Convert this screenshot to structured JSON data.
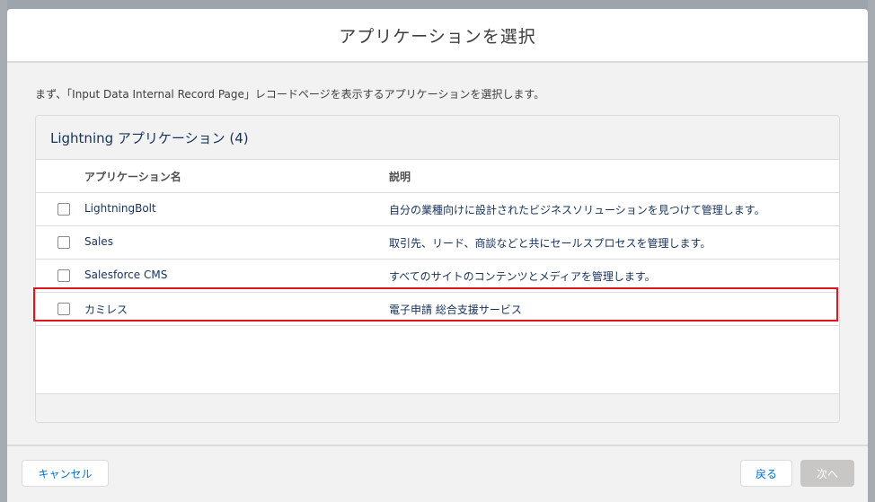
{
  "modal": {
    "title": "アプリケーションを選択",
    "instruction": "まず、「Input Data Internal Record Page」レコードページを表示するアプリケーションを選択します。"
  },
  "card": {
    "title": "Lightning アプリケーション (4)"
  },
  "table": {
    "columns": [
      "アプリケーション名",
      "説明"
    ],
    "rows": [
      {
        "name": "LightningBolt",
        "description": "自分の業種向けに設計されたビジネスソリューションを見つけて管理します。",
        "checked": false
      },
      {
        "name": "Sales",
        "description": "取引先、リード、商談などと共にセールスプロセスを管理します。",
        "checked": false
      },
      {
        "name": "Salesforce CMS",
        "description": "すべてのサイトのコンテンツとメディアを管理します。",
        "checked": false
      },
      {
        "name": "カミレス",
        "description": "電子申請 総合支援サービス",
        "checked": false
      }
    ]
  },
  "footer": {
    "cancel_label": "キャンセル",
    "back_label": "戻る",
    "next_label": "次へ"
  },
  "colors": {
    "highlight": "#e0141e",
    "link": "#0070d2",
    "text": "#16325c"
  }
}
